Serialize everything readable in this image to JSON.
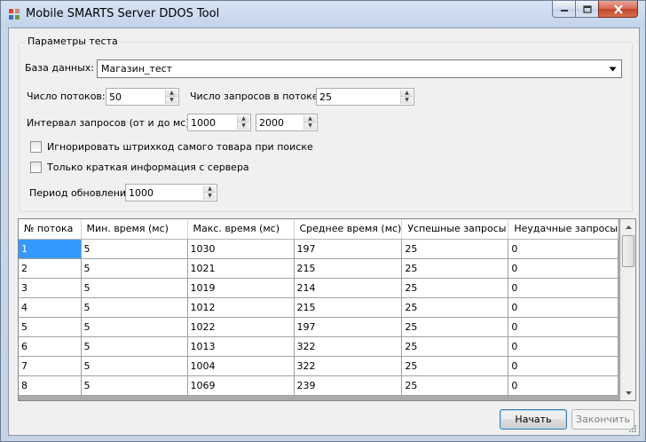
{
  "window": {
    "title": "Mobile SMARTS Server DDOS Tool",
    "icon": "app-grid-icon"
  },
  "params": {
    "group_title": "Параметры теста",
    "database_label": "База данных:",
    "database_value": "Магазин_тест",
    "threads_label": "Число потоков:",
    "threads_value": "50",
    "requests_label": "Число запросов в потоке:",
    "requests_value": "25",
    "interval_label": "Интервал запросов (от и до мс):",
    "interval_from": "1000",
    "interval_to": "2000",
    "ignore_barcode_label": "Игнорировать штрихкод самого товара при поиске",
    "ignore_barcode_checked": false,
    "brief_info_label": "Только краткая информация с сервера",
    "brief_info_checked": false,
    "refresh_label": "Период обновления:",
    "refresh_value": "1000"
  },
  "grid": {
    "columns": [
      "№ потока",
      "Мин. время (мс)",
      "Макс. время  (мс)",
      "Среднее время  (мс)",
      "Успешные запросы",
      "Неудачные запросы"
    ],
    "rows": [
      [
        "1",
        "5",
        "1030",
        "197",
        "25",
        "0"
      ],
      [
        "2",
        "5",
        "1021",
        "215",
        "25",
        "0"
      ],
      [
        "3",
        "5",
        "1019",
        "214",
        "25",
        "0"
      ],
      [
        "4",
        "5",
        "1012",
        "215",
        "25",
        "0"
      ],
      [
        "5",
        "5",
        "1022",
        "197",
        "25",
        "0"
      ],
      [
        "6",
        "5",
        "1013",
        "322",
        "25",
        "0"
      ],
      [
        "7",
        "5",
        "1004",
        "322",
        "25",
        "0"
      ],
      [
        "8",
        "5",
        "1069",
        "239",
        "25",
        "0"
      ]
    ],
    "selected_row": 0
  },
  "buttons": {
    "start": "Начать",
    "stop": "Закончить"
  },
  "colors": {
    "selection": "#3399ff",
    "close_button": "#c2442b"
  }
}
